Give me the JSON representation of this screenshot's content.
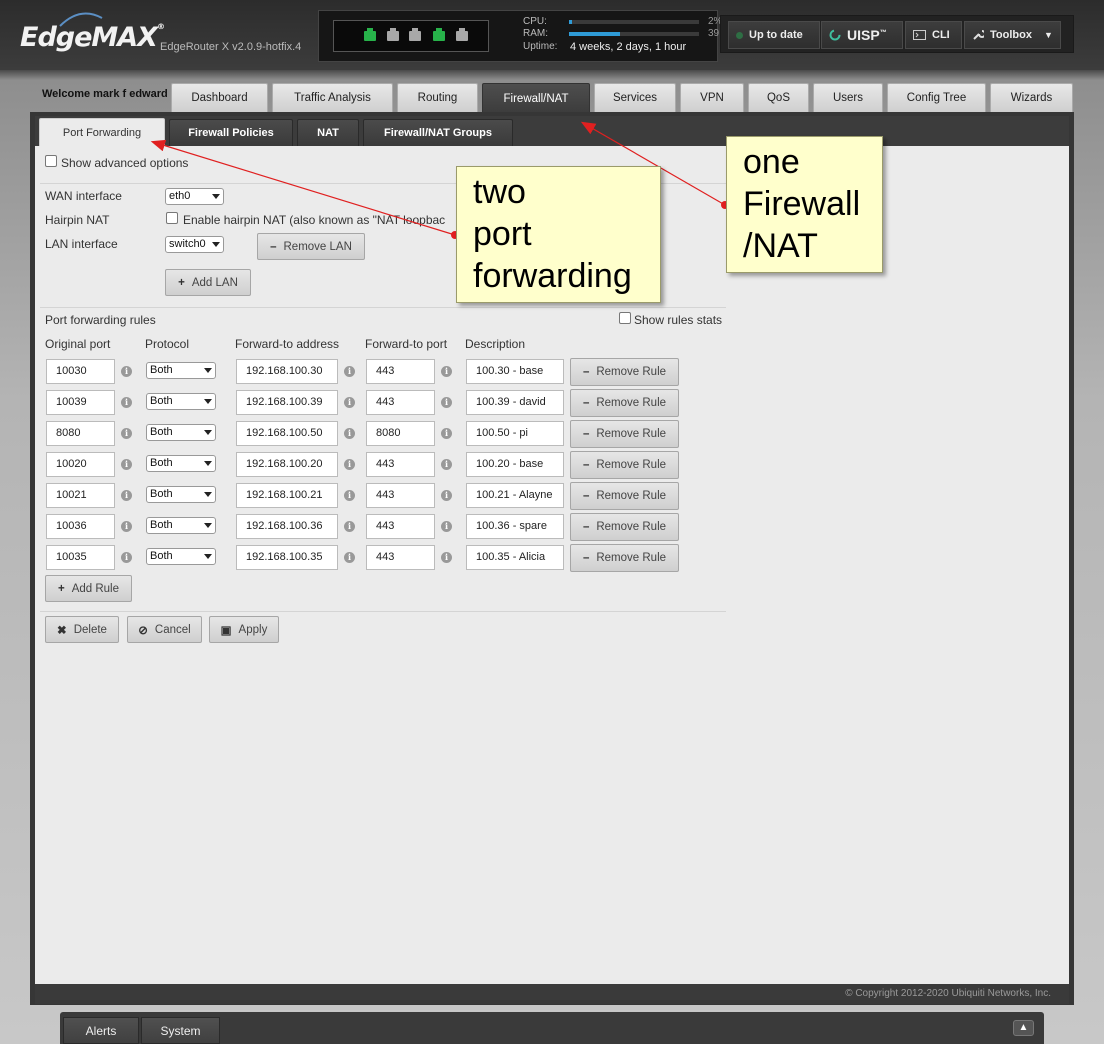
{
  "header": {
    "logo": "EdgeMAX",
    "logo_mark": "®",
    "version": "EdgeRouter X v2.0.9-hotfix.4",
    "cpu_label": "CPU:",
    "ram_label": "RAM:",
    "uptime_label": "Uptime:",
    "uptime_value": "4 weeks, 2 days, 1 hour",
    "cpu_percent_text": "2%",
    "ram_percent_text": "39",
    "cpu_load": 0.02,
    "ram_load": 0.39,
    "ports": [
      "green",
      "gray",
      "gray",
      "green",
      "gray"
    ],
    "update_status": "Up to date",
    "uisp_label": "UISP",
    "uisp_mark": "™",
    "cli_label": "CLI",
    "toolbox_label": "Toolbox"
  },
  "welcome": "Welcome mark f edward",
  "main_tabs": [
    "Dashboard",
    "Traffic Analysis",
    "Routing",
    "Firewall/NAT",
    "Services",
    "VPN",
    "QoS",
    "Users",
    "Config Tree",
    "Wizards"
  ],
  "active_main_tab": "Firewall/NAT",
  "sub_tabs": [
    "Port Forwarding",
    "Firewall Policies",
    "NAT",
    "Firewall/NAT Groups"
  ],
  "active_sub_tab": "Port Forwarding",
  "form": {
    "show_advanced_label": "Show advanced options",
    "wan_label": "WAN interface",
    "wan_value": "eth0",
    "hairpin_label": "Hairpin NAT",
    "hairpin_text": "Enable hairpin NAT (also known as \"NAT loopbac",
    "lan_label": "LAN interface",
    "lan_value": "switch0",
    "remove_lan_label": "Remove LAN",
    "add_lan_label": "Add LAN",
    "rules_title": "Port forwarding rules",
    "show_stats_label": "Show rules stats",
    "col_original_port": "Original port",
    "col_protocol": "Protocol",
    "col_forward_address": "Forward-to address",
    "col_forward_port": "Forward-to port",
    "col_description": "Description",
    "remove_rule_label": "Remove Rule",
    "add_rule_label": "Add Rule",
    "delete_label": "Delete",
    "cancel_label": "Cancel",
    "apply_label": "Apply"
  },
  "rules": [
    {
      "port": "10030",
      "protocol": "Both",
      "address": "192.168.100.30",
      "fport": "443",
      "desc": "100.30 - base"
    },
    {
      "port": "10039",
      "protocol": "Both",
      "address": "192.168.100.39",
      "fport": "443",
      "desc": "100.39 - david"
    },
    {
      "port": "8080",
      "protocol": "Both",
      "address": "192.168.100.50",
      "fport": "8080",
      "desc": "100.50 - pi"
    },
    {
      "port": "10020",
      "protocol": "Both",
      "address": "192.168.100.20",
      "fport": "443",
      "desc": "100.20 - base"
    },
    {
      "port": "10021",
      "protocol": "Both",
      "address": "192.168.100.21",
      "fport": "443",
      "desc": "100.21 - Alayne"
    },
    {
      "port": "10036",
      "protocol": "Both",
      "address": "192.168.100.36",
      "fport": "443",
      "desc": "100.36 - spare"
    },
    {
      "port": "10035",
      "protocol": "Both",
      "address": "192.168.100.35",
      "fport": "443",
      "desc": "100.35 - Alicia"
    }
  ],
  "annotations": {
    "note_two": "two\nport\nforwarding",
    "note_one": "one\nFirewall\n/NAT"
  },
  "footer": {
    "copyright": "© Copyright 2012-2020 Ubiquiti Networks, Inc."
  },
  "bottom_tabs": [
    "Alerts",
    "System"
  ],
  "colors": {
    "port_green": "#27b24a",
    "port_gray": "#a8a8a8",
    "note_bg": "#ffffcc",
    "arrow": "#e02020"
  }
}
